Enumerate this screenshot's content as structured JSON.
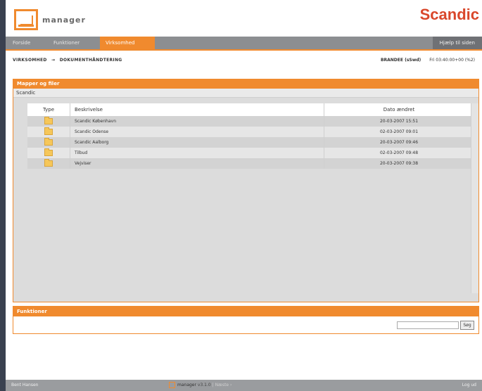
{
  "header": {
    "logo_text": "manager",
    "brand": "Scandic"
  },
  "nav": {
    "tabs": [
      "Forside",
      "Funktioner",
      "Virksomhed"
    ],
    "active_tab": "Virksomhed",
    "right_label": "Hjælp til siden"
  },
  "breadcrumb": {
    "items": [
      "VIRKSOMHED",
      "DOKUMENTHÅNDTERING"
    ],
    "arrow": "→"
  },
  "user": {
    "name": "BRANDEE (sSwd)",
    "info": "Fri 03:40:00+00 (%2)"
  },
  "panel": {
    "title": "Mapper og filer",
    "subtitle": "Scandic",
    "columns": [
      "Type",
      "Beskrivelse",
      "Dato ændret"
    ],
    "rows": [
      {
        "name": "Scandic København",
        "date": "20-03-2007 15:51"
      },
      {
        "name": "Scandic Odense",
        "date": "02-03-2007 09:01"
      },
      {
        "name": "Scandic Aalborg",
        "date": "20-03-2007 09:46"
      },
      {
        "name": "Tilbud",
        "date": "02-03-2007 09:48"
      },
      {
        "name": "Vejviser",
        "date": "20-03-2007 09:38"
      }
    ]
  },
  "functions": {
    "title": "Funktioner",
    "search_value": "",
    "search_button": "Søg"
  },
  "footer": {
    "left": "Bent Hansen",
    "product": "manager",
    "version": "v3.1.0",
    "rest": "| Næste ›",
    "right": "Log ud"
  },
  "colors": {
    "accent": "#f08a2e",
    "brand": "#d9472b",
    "nav": "#8c8e91"
  }
}
